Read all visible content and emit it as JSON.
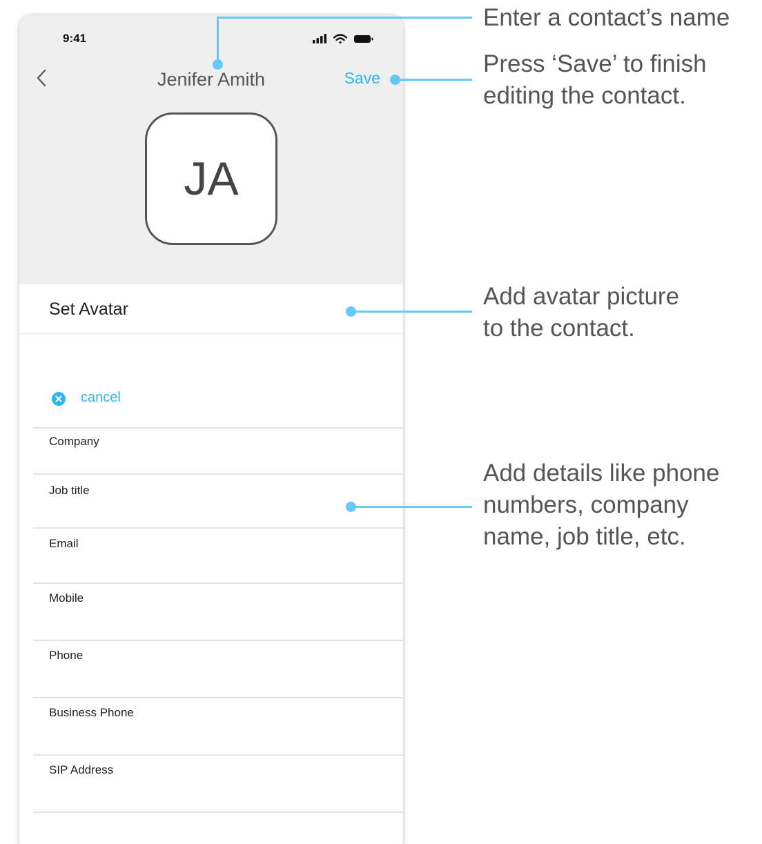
{
  "status_bar": {
    "time": "9:41"
  },
  "nav": {
    "title": "Jenifer Amith",
    "save_label": "Save"
  },
  "avatar": {
    "initials": "JA"
  },
  "set_avatar_label": "Set Avatar",
  "cancel_label": "cancel",
  "fields": [
    {
      "label": "Company"
    },
    {
      "label": "Job title"
    },
    {
      "label": "Email"
    },
    {
      "label": "Mobile"
    },
    {
      "label": "Phone"
    },
    {
      "label": "Business Phone"
    },
    {
      "label": "SIP Address"
    }
  ],
  "annotations": {
    "name": [
      "Enter a contact’s name"
    ],
    "save": [
      "Press ‘Save’ to finish",
      "editing the contact."
    ],
    "avatar": [
      "Add avatar picture",
      "to the contact."
    ],
    "details": [
      "Add details like phone",
      "numbers, company",
      "name, job title, etc."
    ]
  },
  "colors": {
    "accent": "#2fb4ee",
    "annotation_line": "#66c8f5",
    "header_bg": "#efefef"
  },
  "icons": {
    "back": "chevron-left-icon",
    "cancel": "close-circle-icon",
    "signal": "signal-icon",
    "wifi": "wifi-icon",
    "battery": "battery-icon"
  }
}
